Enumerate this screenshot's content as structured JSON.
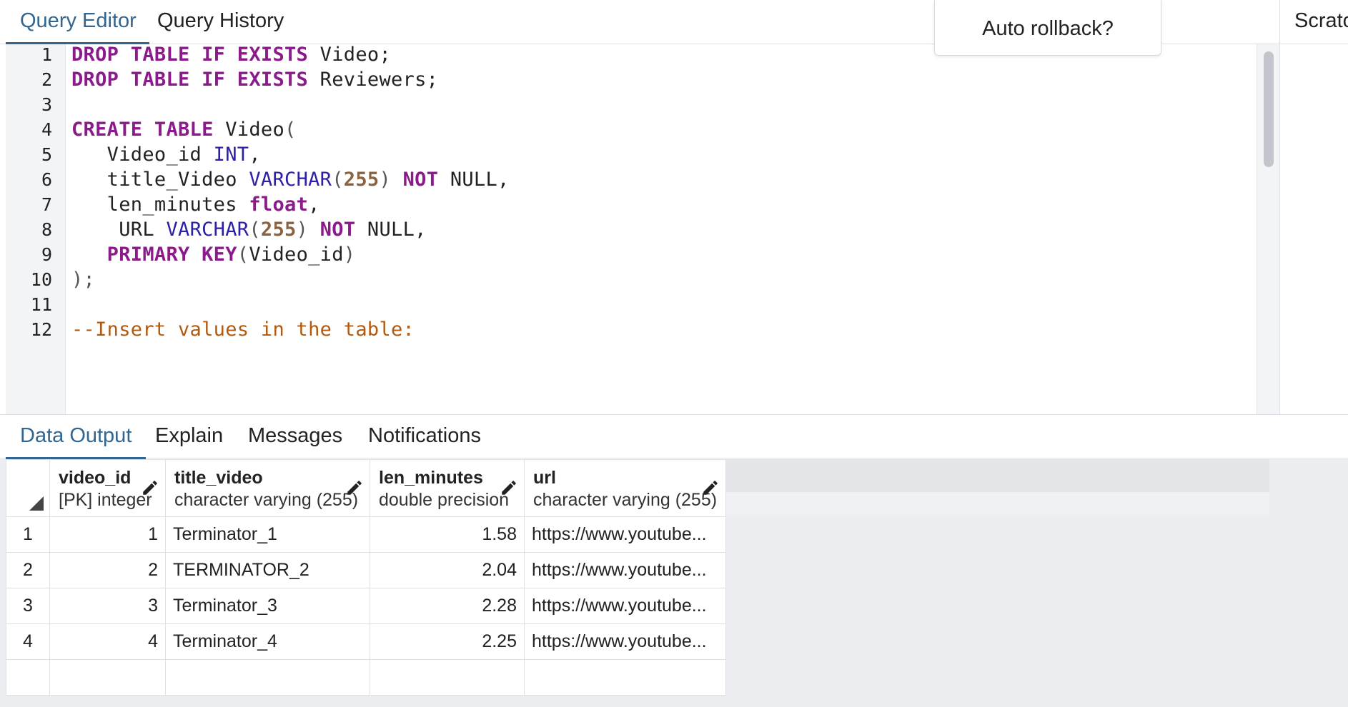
{
  "top_tabs": {
    "query_editor": "Query Editor",
    "query_history": "Query History"
  },
  "popover": {
    "auto_rollback": "Auto rollback?"
  },
  "right_panel": {
    "scratch_label": "Scratc"
  },
  "editor": {
    "line_numbers": [
      "1",
      "2",
      "3",
      "4",
      "5",
      "6",
      "7",
      "8",
      "9",
      "10",
      "11",
      "12"
    ],
    "lines": [
      [
        {
          "t": "kw",
          "v": "DROP TABLE IF EXISTS"
        },
        {
          "t": "id",
          "v": " Video;"
        }
      ],
      [
        {
          "t": "kw",
          "v": "DROP TABLE IF EXISTS"
        },
        {
          "t": "id",
          "v": " Reviewers;"
        }
      ],
      [],
      [
        {
          "t": "kw",
          "v": "CREATE TABLE"
        },
        {
          "t": "id",
          "v": " Video"
        },
        {
          "t": "pu",
          "v": "("
        }
      ],
      [
        {
          "t": "id",
          "v": "   Video_id "
        },
        {
          "t": "ty",
          "v": "INT"
        },
        {
          "t": "id",
          "v": ","
        }
      ],
      [
        {
          "t": "id",
          "v": "   title_Video "
        },
        {
          "t": "ty",
          "v": "VARCHAR"
        },
        {
          "t": "pu",
          "v": "("
        },
        {
          "t": "num",
          "v": "255"
        },
        {
          "t": "pu",
          "v": ")"
        },
        {
          "t": "id",
          "v": " "
        },
        {
          "t": "kw",
          "v": "NOT"
        },
        {
          "t": "id",
          "v": " NULL,"
        }
      ],
      [
        {
          "t": "id",
          "v": "   len_minutes "
        },
        {
          "t": "kw",
          "v": "float"
        },
        {
          "t": "id",
          "v": ","
        }
      ],
      [
        {
          "t": "id",
          "v": "    URL "
        },
        {
          "t": "ty",
          "v": "VARCHAR"
        },
        {
          "t": "pu",
          "v": "("
        },
        {
          "t": "num",
          "v": "255"
        },
        {
          "t": "pu",
          "v": ")"
        },
        {
          "t": "id",
          "v": " "
        },
        {
          "t": "kw",
          "v": "NOT"
        },
        {
          "t": "id",
          "v": " NULL,"
        }
      ],
      [
        {
          "t": "id",
          "v": "   "
        },
        {
          "t": "kw",
          "v": "PRIMARY KEY"
        },
        {
          "t": "pu",
          "v": "("
        },
        {
          "t": "id",
          "v": "Video_id"
        },
        {
          "t": "pu",
          "v": ")"
        }
      ],
      [
        {
          "t": "pu",
          "v": ");"
        }
      ],
      [],
      [
        {
          "t": "cm",
          "v": "--Insert values in the table:"
        }
      ]
    ]
  },
  "bottom_tabs": {
    "data_output": "Data Output",
    "explain": "Explain",
    "messages": "Messages",
    "notifications": "Notifications"
  },
  "grid": {
    "columns": [
      {
        "name": "video_id",
        "type": "[PK] integer"
      },
      {
        "name": "title_video",
        "type": "character varying (255)"
      },
      {
        "name": "len_minutes",
        "type": "double precision"
      },
      {
        "name": "url",
        "type": "character varying (255)"
      }
    ],
    "rows": [
      {
        "num": "1",
        "video_id": "1",
        "title_video": "Terminator_1",
        "len_minutes": "1.58",
        "url": "https://www.youtube..."
      },
      {
        "num": "2",
        "video_id": "2",
        "title_video": "TERMINATOR_2",
        "len_minutes": "2.04",
        "url": "https://www.youtube..."
      },
      {
        "num": "3",
        "video_id": "3",
        "title_video": "Terminator_3",
        "len_minutes": "2.28",
        "url": "https://www.youtube..."
      },
      {
        "num": "4",
        "video_id": "4",
        "title_video": "Terminator_4",
        "len_minutes": "2.25",
        "url": "https://www.youtube..."
      }
    ]
  },
  "colors": {
    "accent": "#326690",
    "keyword": "#8b1a8b",
    "type": "#2b20a6",
    "number": "#8a6240",
    "comment": "#b2590e"
  },
  "icons": {
    "edit_column": "pencil-icon",
    "select_all": "select-all-corner-icon"
  }
}
